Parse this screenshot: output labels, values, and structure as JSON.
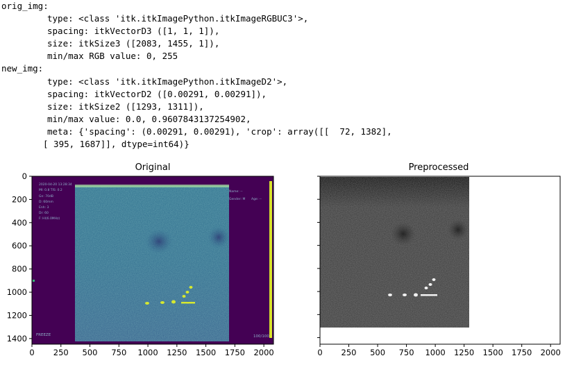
{
  "console": {
    "lines": [
      {
        "text": "orig_img:",
        "indent": 0
      },
      {
        "text": "type: <class 'itk.itkImagePython.itkImageRGBUC3'>,",
        "indent": 1
      },
      {
        "text": "spacing: itkVectorD3 ([1, 1, 1]),",
        "indent": 1
      },
      {
        "text": "size: itkSize3 ([2083, 1455, 1]),",
        "indent": 1
      },
      {
        "text": "min/max RGB value: 0, 255",
        "indent": 1
      },
      {
        "text": "new_img:",
        "indent": 0
      },
      {
        "text": "type: <class 'itk.itkImagePython.itkImageD2'>,",
        "indent": 1
      },
      {
        "text": "spacing: itkVectorD2 ([0.00291, 0.00291]),",
        "indent": 1
      },
      {
        "text": "size: itkSize2 ([1293, 1311]),",
        "indent": 1
      },
      {
        "text": "min/max value: 0.0, 0.9607843137254902,",
        "indent": 1
      },
      {
        "text": "meta: {'spacing': (0.00291, 0.00291), 'crop': array([[  72, 1382],",
        "indent": 1
      },
      {
        "text": "[ 395, 1687]], dtype=int64)}",
        "indent": 2
      }
    ]
  },
  "plots": {
    "original": {
      "title": "Original",
      "xticks": [
        "0",
        "250",
        "500",
        "750",
        "1000",
        "1250",
        "1500",
        "1750",
        "2000"
      ],
      "yticks": [
        "0",
        "200",
        "400",
        "600",
        "800",
        "1000",
        "1200",
        "1400"
      ],
      "overlay": {
        "timestamp": "2020-04-20 13:28:34",
        "params": [
          "MI: 0.8  TIS: 0.2",
          "Gn: 70dB",
          "D: 60mm",
          "Enh: 3",
          "Dr: 60",
          "F: HI(6.0MHz)"
        ],
        "name": "Name: --",
        "gender": "Gender: M",
        "age": "Age: --",
        "freeze": "FREEZE",
        "frame": "100/100"
      }
    },
    "preprocessed": {
      "title": "Preprocessed",
      "xticks": [
        "0",
        "250",
        "500",
        "750",
        "1000",
        "1250",
        "1500",
        "1750",
        "2000"
      ]
    }
  },
  "colors": {
    "viridis_bg": "#440154",
    "viridis_mid": "#31688e",
    "viridis_bright": "#fde725"
  }
}
